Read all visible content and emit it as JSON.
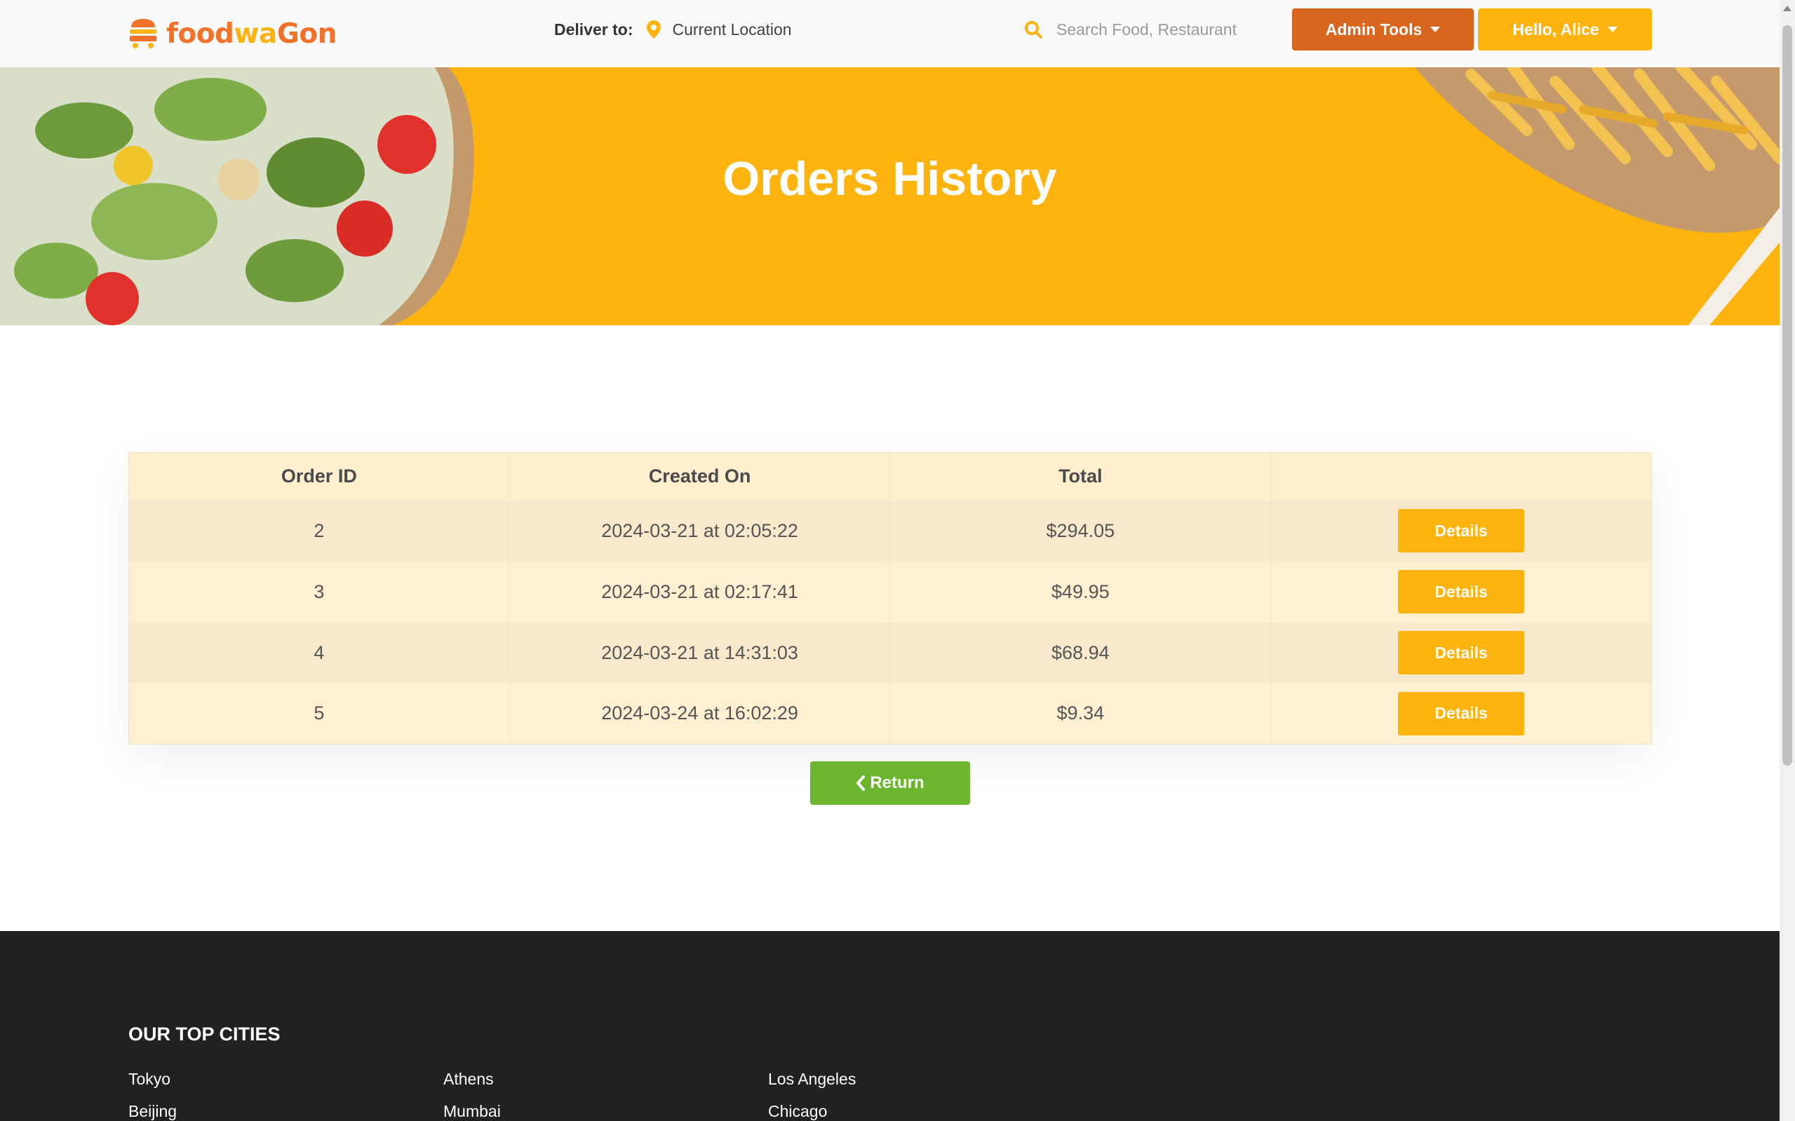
{
  "brand": {
    "name_part1": "food",
    "name_part2": "wa",
    "name_part3": "Gon"
  },
  "nav": {
    "deliver_label": "Deliver to:",
    "deliver_location": "Current Location",
    "search_placeholder": "Search Food, Restaurant",
    "admin_label": "Admin Tools",
    "user_label": "Hello, Alice"
  },
  "hero": {
    "title": "Orders History"
  },
  "orders": {
    "headers": [
      "Order ID",
      "Created On",
      "Total",
      ""
    ],
    "rows": [
      {
        "id": "2",
        "created": "2024-03-21 at 02:05:22",
        "total": "$294.05",
        "action": "Details"
      },
      {
        "id": "3",
        "created": "2024-03-21 at 02:17:41",
        "total": "$49.95",
        "action": "Details"
      },
      {
        "id": "4",
        "created": "2024-03-21 at 14:31:03",
        "total": "$68.94",
        "action": "Details"
      },
      {
        "id": "5",
        "created": "2024-03-24 at 16:02:29",
        "total": "$9.34",
        "action": "Details"
      }
    ],
    "return_label": "Return"
  },
  "footer": {
    "title": "OUR TOP CITIES",
    "cities": [
      "Tokyo",
      "Athens",
      "Los Angeles",
      "Beijing",
      "Mumbai",
      "Chicago"
    ]
  },
  "colors": {
    "brand_orange": "#f17228",
    "brand_yellow": "#ffb30e",
    "admin_button": "#d9661f",
    "return_button": "#6bb52f",
    "footer_bg": "#212121"
  },
  "icons": [
    "logo-burger-icon",
    "location-pin-icon",
    "search-icon",
    "caret-down-icon",
    "chevron-left-icon"
  ]
}
